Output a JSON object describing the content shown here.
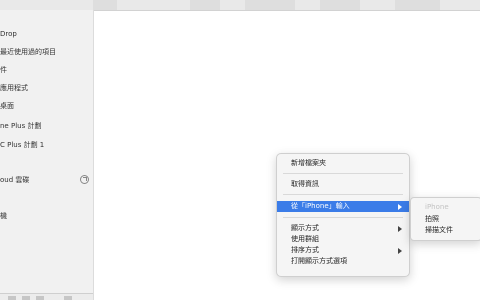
{
  "sidebar": {
    "items": [
      {
        "label": "Drop"
      },
      {
        "label": "最近使用過的項目"
      },
      {
        "label": "件"
      },
      {
        "label": "應用程式"
      },
      {
        "label": "桌面"
      },
      {
        "label": "ne Plus 計劃"
      },
      {
        "label": "C Plus 計劃 1"
      },
      {
        "label": "oud 雲碟"
      },
      {
        "label": "機"
      }
    ]
  },
  "context_menu": {
    "items": [
      {
        "label": "新增檔案夾"
      },
      {
        "label": "取得資訊"
      },
      {
        "label": "從「iPhone」輸入"
      },
      {
        "label": "顯示方式"
      },
      {
        "label": "使用群組"
      },
      {
        "label": "排序方式"
      },
      {
        "label": "打開顯示方式選項"
      }
    ]
  },
  "submenu": {
    "items": [
      {
        "label": "iPhone"
      },
      {
        "label": "拍照"
      },
      {
        "label": "掃描文件"
      }
    ]
  },
  "colors": {
    "highlight": "#3b7ce8",
    "sidebar_bg": "#f1f1f1",
    "menu_bg": "#f5f5f5"
  },
  "icons": {
    "eject": "eject-icon",
    "submenu_arrow": "chevron-right-icon"
  }
}
